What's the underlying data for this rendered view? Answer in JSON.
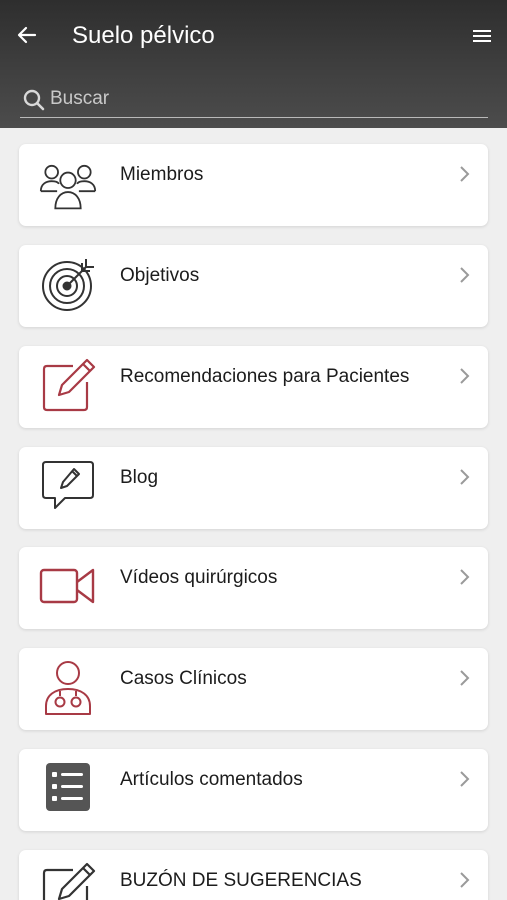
{
  "header": {
    "title": "Suelo pélvico",
    "back_icon": "arrow-left-icon",
    "menu_icon": "hamburger-menu-icon",
    "background": "#3a3a3a"
  },
  "search": {
    "placeholder": "Buscar",
    "value": "",
    "icon": "search-icon"
  },
  "menu_items": [
    {
      "label": "Miembros",
      "icon": "people-group-icon",
      "icon_color": "#333333"
    },
    {
      "label": "Objetivos",
      "icon": "target-icon",
      "icon_color": "#333333"
    },
    {
      "label": "Recomendaciones para Pacientes",
      "icon": "edit-note-icon",
      "icon_color": "#a83a45"
    },
    {
      "label": "Blog",
      "icon": "chat-pencil-icon",
      "icon_color": "#333333"
    },
    {
      "label": "Vídeos quirúrgicos",
      "icon": "video-camera-icon",
      "icon_color": "#a83a45"
    },
    {
      "label": "Casos Clínicos",
      "icon": "doctor-icon",
      "icon_color": "#a83a45"
    },
    {
      "label": "Artículos comentados",
      "icon": "list-document-icon",
      "icon_color": "#555555"
    },
    {
      "label": "BUZÓN DE SUGERENCIAS",
      "icon": "edit-note-icon",
      "icon_color": "#333333"
    }
  ],
  "colors": {
    "accent": "#a83a45",
    "chevron": "#9a9a9a",
    "page_background": "#efefef"
  }
}
